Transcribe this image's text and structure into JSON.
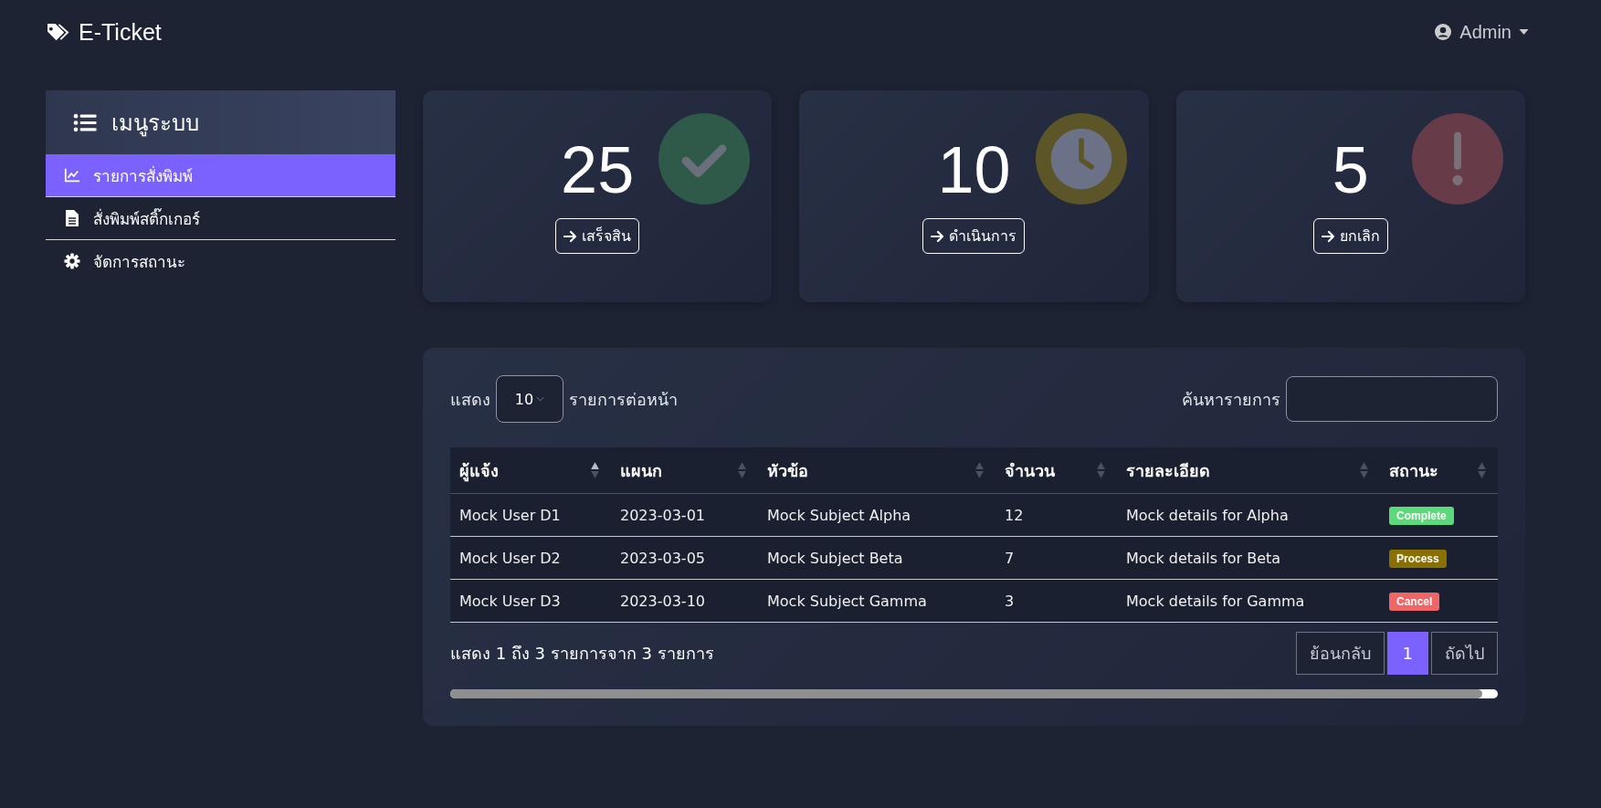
{
  "navbar": {
    "brand": "E-Ticket",
    "user": "Admin"
  },
  "sidebar": {
    "title": "เมนูระบบ",
    "items": [
      {
        "label": "รายการสั่งพิมพ์",
        "kind": "chart",
        "selected": true
      },
      {
        "label": "สั่งพิมพ์สติ๊กเกอร์",
        "kind": "file",
        "selected": false
      },
      {
        "label": "จัดการสถานะ",
        "kind": "gear",
        "selected": false
      }
    ]
  },
  "stats": [
    {
      "count": "25",
      "button": "เสร็จสิน",
      "kind": "check",
      "color": "#2f5a49"
    },
    {
      "count": "10",
      "button": "ดำเนินการ",
      "kind": "clock",
      "color": "#5c5528"
    },
    {
      "count": "5",
      "button": "ยกเลิก",
      "kind": "alert",
      "color": "#673b47"
    }
  ],
  "table": {
    "length_label_before": "แสดง",
    "length_value": "10",
    "length_label_after": "รายการต่อหน้า",
    "search_label": "ค้นหารายการ",
    "columns": [
      {
        "label": "ผู้แจ้ง",
        "sorted": true
      },
      {
        "label": "แผนก",
        "sorted": false
      },
      {
        "label": "หัวข้อ",
        "sorted": false
      },
      {
        "label": "จำนวน",
        "sorted": false
      },
      {
        "label": "รายละเอียด",
        "sorted": false
      },
      {
        "label": "สถานะ",
        "sorted": false
      }
    ],
    "rows": [
      {
        "cells": [
          "Mock User D1",
          "2023-03-01",
          "Mock Subject Alpha",
          "12",
          "Mock details for Alpha"
        ],
        "status": "Complete",
        "color": "#5cd97a"
      },
      {
        "cells": [
          "Mock User D2",
          "2023-03-05",
          "Mock Subject Beta",
          "7",
          "Mock details for Beta"
        ],
        "status": "Process",
        "color": "#8a7000"
      },
      {
        "cells": [
          "Mock User D3",
          "2023-03-10",
          "Mock Subject Gamma",
          "3",
          "Mock details for Gamma"
        ],
        "status": "Cancel",
        "color": "#f06565"
      }
    ],
    "info": "แสดง 1 ถึง 3 รายการจาก 3 รายการ",
    "pagination": [
      {
        "label": "ย้อนกลับ",
        "selected": false
      },
      {
        "label": "1",
        "selected": true
      },
      {
        "label": "ถัดไป",
        "selected": false
      }
    ]
  }
}
